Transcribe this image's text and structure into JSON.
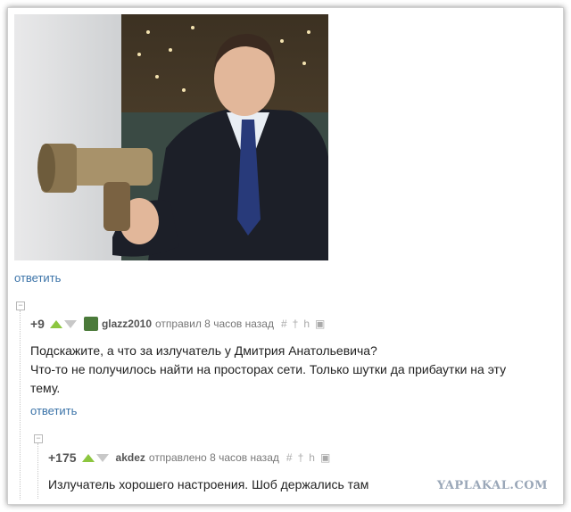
{
  "post": {
    "reply_label": "ответить"
  },
  "comments": [
    {
      "score": "+9",
      "author": "glazz2010",
      "meta": "отправил 8 часов назад",
      "text_lines": [
        "Подскажите, а что за излучатель у Дмитрия Анатольевича?",
        "Что-то не получилось найти на просторах сети. Только шутки да прибаутки на эту",
        "тему."
      ],
      "reply_label": "ответить"
    },
    {
      "score": "+175",
      "author": "akdez",
      "meta": "отправлено 8 часов назад",
      "text_lines": [
        "Излучатель хорошего настроения. Шоб держались там"
      ]
    }
  ],
  "actions": {
    "hash": "#",
    "pin": "†",
    "h": "h",
    "save": "▣"
  },
  "collapse_symbol": "−",
  "watermark": "YAPLAKAL.COM",
  "colors": {
    "link": "#3b73a8",
    "upvote": "#8cc63f",
    "downvote": "#c8c8c8",
    "watermark": "#9aa7b8"
  }
}
